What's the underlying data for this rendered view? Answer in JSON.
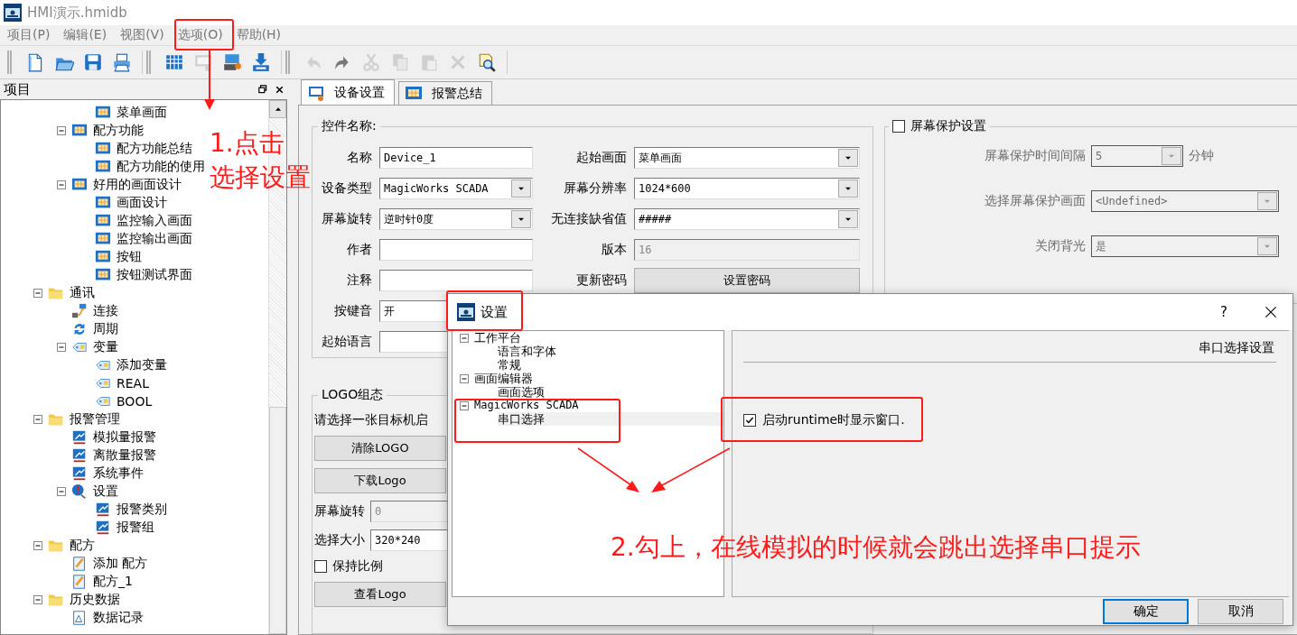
{
  "window": {
    "title": "HMI演示.hmidb"
  },
  "menu": [
    "项目(P)",
    "编辑(E)",
    "视图(V)",
    "选项(O)",
    "帮助(H)"
  ],
  "toolbar_groups": [
    {
      "items": [
        {
          "kind": "new",
          "disabled": false
        },
        {
          "kind": "open",
          "disabled": false
        },
        {
          "kind": "save",
          "disabled": false
        },
        {
          "kind": "print",
          "disabled": false
        }
      ]
    },
    {
      "items": [
        {
          "kind": "grid",
          "disabled": false
        },
        {
          "kind": "screen",
          "disabled": true
        },
        {
          "kind": "screen-download",
          "disabled": false
        },
        {
          "kind": "download",
          "disabled": false
        }
      ]
    },
    {
      "items": [
        {
          "kind": "undo",
          "disabled": true
        },
        {
          "kind": "redo",
          "disabled": false
        },
        {
          "kind": "cut",
          "disabled": true
        },
        {
          "kind": "copy",
          "disabled": true
        },
        {
          "kind": "paste",
          "disabled": true
        },
        {
          "kind": "delete",
          "disabled": true
        },
        {
          "kind": "find",
          "disabled": false
        }
      ]
    }
  ],
  "project_panel": {
    "title": "项目",
    "tree": [
      {
        "children": [
          {
            "children": [
              {
                "label": "菜单画面",
                "kind": "screen"
              }
            ]
          },
          {
            "label": "配方功能",
            "kind": "screen",
            "expanded": true,
            "children": [
              {
                "label": "配方功能总结",
                "kind": "screen"
              },
              {
                "label": "配方功能的使用",
                "kind": "screen"
              }
            ]
          },
          {
            "label": "好用的画面设计",
            "kind": "screen",
            "expanded": true,
            "children": [
              {
                "label": "画面设计",
                "kind": "screen"
              },
              {
                "label": "监控输入画面",
                "kind": "screen"
              },
              {
                "label": "监控输出画面",
                "kind": "screen"
              },
              {
                "label": "按钮",
                "kind": "screen"
              },
              {
                "label": "按钮测试界面",
                "kind": "screen"
              }
            ]
          }
        ]
      },
      {
        "label": "通讯",
        "kind": "folder",
        "expanded": true,
        "children": [
          {
            "label": "连接",
            "kind": "link"
          },
          {
            "label": "周期",
            "kind": "cycle"
          },
          {
            "label": "变量",
            "kind": "tag",
            "expanded": true,
            "children": [
              {
                "label": "添加变量",
                "kind": "tag"
              },
              {
                "label": "REAL",
                "kind": "tag"
              },
              {
                "label": "BOOL",
                "kind": "tag"
              }
            ]
          }
        ]
      },
      {
        "label": "报警管理",
        "kind": "folder",
        "expanded": true,
        "children": [
          {
            "label": "模拟量报警",
            "kind": "alarm"
          },
          {
            "label": "离散量报警",
            "kind": "alarm"
          },
          {
            "label": "系统事件",
            "kind": "alarm"
          },
          {
            "label": "设置",
            "kind": "warning",
            "expanded": true,
            "children": [
              {
                "label": "报警类别",
                "kind": "alarm"
              },
              {
                "label": "报警组",
                "kind": "alarm"
              }
            ]
          }
        ]
      },
      {
        "label": "配方",
        "kind": "folder",
        "expanded": true,
        "children": [
          {
            "label": "添加 配方",
            "kind": "recipe"
          },
          {
            "label": "配方_1",
            "kind": "recipe"
          }
        ]
      },
      {
        "label": "历史数据",
        "kind": "folder",
        "expanded": true,
        "children": [
          {
            "label": "数据记录",
            "kind": "log"
          }
        ]
      }
    ]
  },
  "tabs": [
    {
      "label": "设备设置",
      "selected": true
    },
    {
      "label": "报警总结",
      "selected": false
    }
  ],
  "device_group": {
    "title": "控件名称:",
    "left_fields": [
      {
        "label": "名称",
        "kind": "text",
        "value": "Device_1"
      },
      {
        "label": "设备类型",
        "kind": "combo",
        "value": "MagicWorks SCADA"
      },
      {
        "label": "屏幕旋转",
        "kind": "combo",
        "value": "逆时针0度"
      },
      {
        "label": "作者",
        "kind": "text"
      },
      {
        "label": "注释",
        "kind": "text"
      },
      {
        "label": "按键音",
        "kind": "text",
        "value": "开"
      },
      {
        "label": "起始语言",
        "kind": "text"
      }
    ],
    "right_fields": [
      {
        "label": "起始画面",
        "kind": "combo",
        "value": "菜单画面"
      },
      {
        "label": "屏幕分辨率",
        "kind": "combo",
        "value": "1024*600"
      },
      {
        "label": "无连接缺省值",
        "kind": "combo",
        "value": "#####"
      },
      {
        "label": "版本",
        "kind": "readonly",
        "value": "16"
      },
      {
        "label": "更新密码",
        "kind": "button",
        "value": "设置密码"
      }
    ]
  },
  "screensaver": {
    "title": "屏幕保护设置",
    "checked": false,
    "fields": [
      {
        "label": "屏幕保护时间间隔",
        "kind": "spin",
        "value": "5",
        "unit": "分钟"
      },
      {
        "label": "选择屏幕保护画面",
        "kind": "combo",
        "value": "<Undefined>"
      },
      {
        "label": "关闭背光",
        "kind": "combo",
        "value": "是"
      }
    ]
  },
  "logo_group": {
    "title": "LOGO组态",
    "hint": "请选择一张目标机启",
    "clear_button": "清除LOGO",
    "download_button": "下载Logo",
    "fields": [
      {
        "label": "屏幕旋转",
        "value": "0",
        "disabled": true
      },
      {
        "label": "选择大小",
        "value": "320*240",
        "disabled": false
      }
    ],
    "keep_ratio": {
      "label": "保持比例",
      "checked": false
    },
    "view_button": "查看Logo"
  },
  "settings_dialog": {
    "title": "设置",
    "help": "?",
    "tree": [
      {
        "label": "工作平台",
        "expanded": true,
        "children": [
          {
            "label": "语言和字体",
            "selected": false
          },
          {
            "label": "常规",
            "selected": false
          }
        ]
      },
      {
        "label": "画面编辑器",
        "expanded": true,
        "children": [
          {
            "label": "画面选项",
            "selected": false
          }
        ]
      },
      {
        "label": "MagicWorks SCADA",
        "expanded": true,
        "children": [
          {
            "label": "串口选择",
            "selected": true
          }
        ]
      }
    ],
    "panel_title": "串口选择设置",
    "option": {
      "label": "启动runtime时显示窗口.",
      "checked": true
    },
    "buttons": [
      "确定",
      "取消"
    ]
  },
  "annotations": [
    "1.点击",
    "选择设置",
    "2.勾上，在线模拟的时候就会跳出选择串口提示"
  ]
}
